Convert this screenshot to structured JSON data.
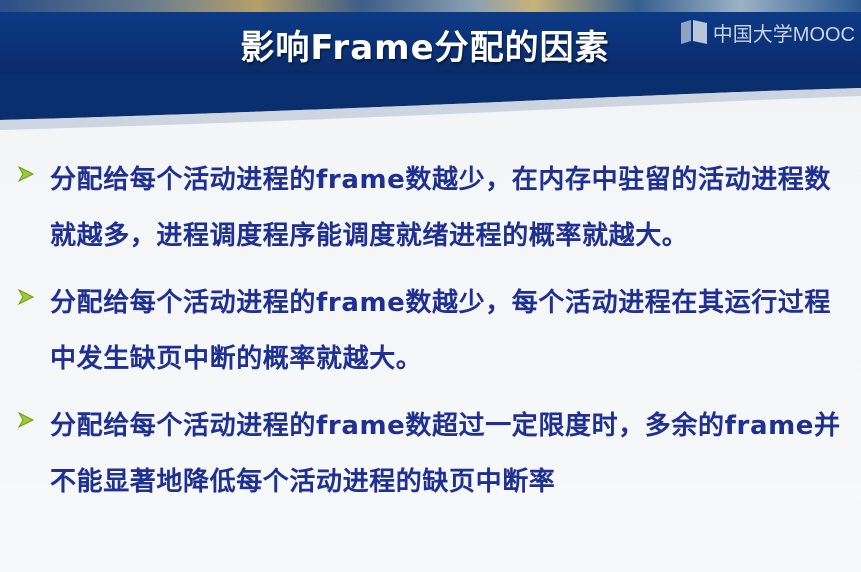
{
  "slide": {
    "title": "影响Frame分配的因素",
    "logo_text": "中国大学MOOC",
    "logo_icon": "mooc-logo-icon",
    "bullet_icon": "chevron-arrow-icon",
    "colors": {
      "header": "#0b3277",
      "text": "#1f2f92",
      "arrow": "#9acd32"
    },
    "bullets": [
      {
        "text": "分配给每个活动进程的frame数越少，在内存中驻留的活动进程数就越多，进程调度程序能调度就绪进程的概率就越大。"
      },
      {
        "text": "分配给每个活动进程的frame数越少，每个活动进程在其运行过程中发生缺页中断的概率就越大。"
      },
      {
        "text": "分配给每个活动进程的frame数超过一定限度时，多余的frame并不能显著地降低每个活动进程的缺页中断率"
      }
    ]
  }
}
